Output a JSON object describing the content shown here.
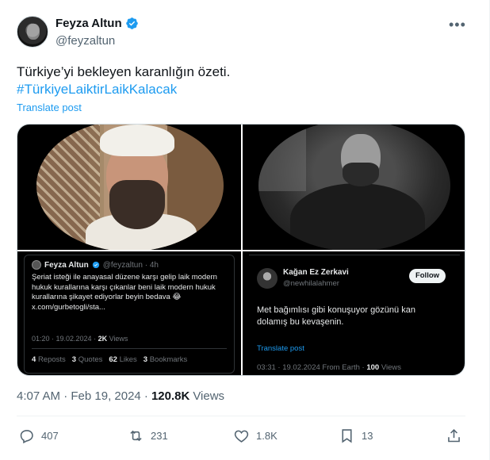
{
  "author": {
    "display_name": "Feyza Altun",
    "handle": "@feyzaltun"
  },
  "tweet": {
    "text": "Türkiye’yi bekleyen karanlığın özeti.",
    "hashtag": "#TürkiyeLaiktirLaikKalacak",
    "translate_label": "Translate post"
  },
  "embed1": {
    "name": "Feyza Altun",
    "handle": "@feyzaltun · 4h",
    "body": "Şeriat isteği ile anayasal düzene karşı gelip laik modern hukuk kurallarına karşı çıkanlar beni laik modern hukuk kurallarına şikayet ediyorlar beyin bedava 😂 x.com/gurbetogli/sta...",
    "time": "01:20 · 19.02.2024 · ",
    "views_count": "2K",
    "views_label": " Views",
    "stats": [
      {
        "count": "4",
        "label": "Reposts"
      },
      {
        "count": "3",
        "label": "Quotes"
      },
      {
        "count": "62",
        "label": "Likes"
      },
      {
        "count": "3",
        "label": "Bookmarks"
      }
    ]
  },
  "embed2": {
    "name": "Kağan Ez Zerkavi",
    "handle": "@newhilalahmer",
    "follow_label": "Follow",
    "body": "Met bağımlısı gibi konuşuyor gözünü kan dolamış bu kevaşenin.",
    "translate_label": "Translate post",
    "meta": "03:31 · 19.02.2024 From Earth · ",
    "views_count": "100",
    "views_label": " Views"
  },
  "meta": {
    "time": "4:07 AM · Feb 19, 2024 · ",
    "views_count": "120.8K",
    "views_label": " Views"
  },
  "actions": {
    "replies": "407",
    "reposts": "231",
    "likes": "1.8K",
    "bookmarks": "13"
  },
  "colors": {
    "accent": "#1d9bf0",
    "text": "#0f1419",
    "secondary": "#536471"
  }
}
